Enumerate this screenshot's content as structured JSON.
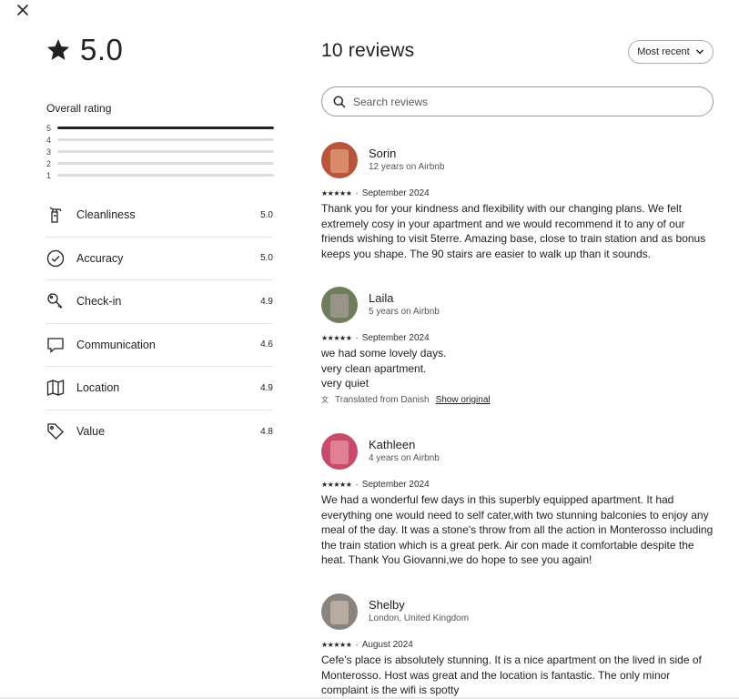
{
  "close_icon": "close-icon",
  "rating": {
    "value": "5.0",
    "icon": "star-icon",
    "overall_label": "Overall rating",
    "distribution": [
      {
        "stars": "5",
        "fraction": 1.0
      },
      {
        "stars": "4",
        "fraction": 0.0
      },
      {
        "stars": "3",
        "fraction": 0.0
      },
      {
        "stars": "2",
        "fraction": 0.0
      },
      {
        "stars": "1",
        "fraction": 0.0
      }
    ]
  },
  "categories": [
    {
      "name": "Cleanliness",
      "value": "5.0",
      "icon": "spray-bottle-icon"
    },
    {
      "name": "Accuracy",
      "value": "5.0",
      "icon": "check-circle-icon"
    },
    {
      "name": "Check-in",
      "value": "4.9",
      "icon": "key-icon"
    },
    {
      "name": "Communication",
      "value": "4.6",
      "icon": "message-icon"
    },
    {
      "name": "Location",
      "value": "4.9",
      "icon": "map-icon"
    },
    {
      "name": "Value",
      "value": "4.8",
      "icon": "tag-icon"
    }
  ],
  "reviews_header": {
    "title": "10 reviews",
    "sort_label": "Most recent",
    "search_placeholder": "Search reviews"
  },
  "reviews": [
    {
      "name": "Sorin",
      "sub": "12 years on Airbnb",
      "stars": "★★★★★",
      "date": "September 2024",
      "text": "Thank you for your kindness and flexibility with our changing plans. We felt\nextremely cosy in your apartment and we would recommend it to any of our\nfriends wishing to visit 5terre. Amazing base, close to train station and as bonus\nkeeps you shape. The 90 stairs are easier to walk up than it sounds."
    },
    {
      "name": "Laila",
      "sub": "5 years on Airbnb",
      "stars": "★★★★★",
      "date": "September 2024",
      "text": "we had some lovely days.\nvery clean apartment.\nvery quiet",
      "translated": "Translated from Danish",
      "show_original": "Show original"
    },
    {
      "name": "Kathleen",
      "sub": "4 years on Airbnb",
      "stars": "★★★★★",
      "date": "September 2024",
      "text": "We had a wonderful few days in this superbly equipped apartment. It had\neverything one would need to self cater,with two stunning balconies to enjoy any\nmeal of the day. It was a stone's throw from all the action in Monterosso including\nthe train station which is a great perk. Air con made it comfortable despite the\nheat. Thank You Giovanni,we do hope to see you again!"
    },
    {
      "name": "Shelby",
      "sub": "London, United Kingdom",
      "stars": "★★★★★",
      "date": "August 2024",
      "text": "Cefe's place is absolutely stunning. It is a nice apartment on the lived in side of\nMonterosso. Host was great and the location is fantastic. The only minor\ncomplaint is the wifi is spotty"
    }
  ]
}
